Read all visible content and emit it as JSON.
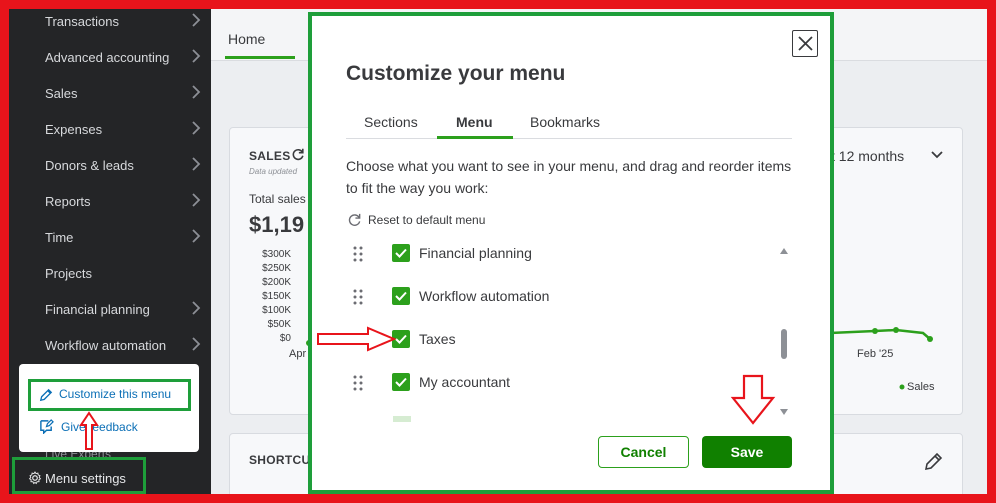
{
  "sidebar": {
    "items": [
      {
        "label": "Transactions",
        "chevron": true
      },
      {
        "label": "Advanced accounting",
        "chevron": true
      },
      {
        "label": "Sales",
        "chevron": true
      },
      {
        "label": "Expenses",
        "chevron": true
      },
      {
        "label": "Donors & leads",
        "chevron": true
      },
      {
        "label": "Reports",
        "chevron": true
      },
      {
        "label": "Time",
        "chevron": true
      },
      {
        "label": "Projects",
        "chevron": false
      },
      {
        "label": "Financial planning",
        "chevron": true
      },
      {
        "label": "Workflow automation",
        "chevron": true
      }
    ],
    "popup": {
      "customize_label": "Customize this menu",
      "feedback_label": "Give feedback"
    },
    "live_experts_label": "Live Experts",
    "menu_settings_label": "Menu settings"
  },
  "main": {
    "home_tab": "Home",
    "sales_card": {
      "title": "SALES",
      "data_updated": "Data updated",
      "total_label": "Total sales",
      "total_amount": "$1,19",
      "range_label": "t 12 months",
      "legend_label": "Sales",
      "y_ticks": [
        "$300K",
        "$250K",
        "$200K",
        "$150K",
        "$100K",
        "$50K",
        "$0"
      ],
      "x_labels": [
        "Apr",
        "Feb '25"
      ]
    },
    "shortcuts_title": "SHORTCU"
  },
  "modal": {
    "title": "Customize your menu",
    "tabs": [
      {
        "label": "Sections",
        "active": false
      },
      {
        "label": "Menu",
        "active": true
      },
      {
        "label": "Bookmarks",
        "active": false
      }
    ],
    "instructions": "Choose what you want to see in your menu, and drag and reorder items to fit the way you work:",
    "reset_label": "Reset to default menu",
    "items": [
      {
        "label": "Financial planning",
        "checked": true
      },
      {
        "label": "Workflow automation",
        "checked": true
      },
      {
        "label": "Taxes",
        "checked": true
      },
      {
        "label": "My accountant",
        "checked": true
      }
    ],
    "cancel_label": "Cancel",
    "save_label": "Save"
  },
  "colors": {
    "annotation_red": "#e8141b",
    "annotation_green": "#1e9e3a",
    "brand_green": "#2ca01c",
    "save_green": "#108000",
    "sidebar_bg": "#242527"
  }
}
